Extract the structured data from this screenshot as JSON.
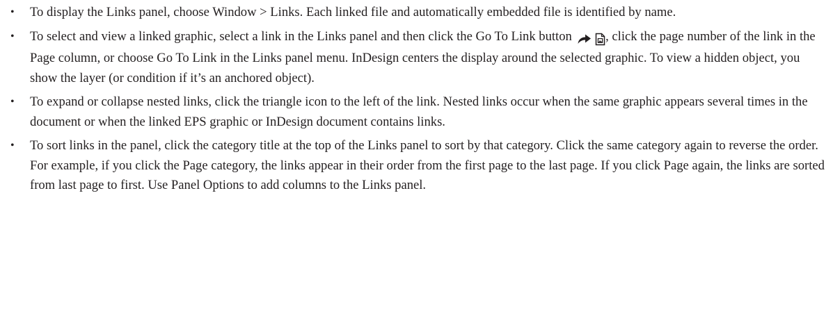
{
  "bullet_glyph": "•",
  "items": [
    {
      "text": "To display the Links panel, choose Window > Links. Each linked file and automatically embedded file is identified by name."
    },
    {
      "text_before_icon": "To select and view a linked graphic, select a link in the Links panel and then click the Go To Link button",
      "icon": "go-to-link-icon",
      "text_after_icon": ", click the page number of the link in the Page column, or choose Go To Link in the Links panel menu. InDesign centers the display around the selected graphic. To view a hidden object, you show the layer (or condition if it’s an anchored object)."
    },
    {
      "text": "To expand or collapse nested links, click the triangle icon to the left of the link. Nested links occur when the same graphic appears several times in the document or when the linked EPS graphic or InDesign document contains links."
    },
    {
      "text": "To sort links in the panel, click the category title at the top of the Links panel to sort by that category. Click the same category again to reverse the order. For example, if you click the Page category, the links appear in their order from the first page to the last page. If you click Page again, the links are sorted from last page to first. Use Panel Options to add columns to the Links panel."
    }
  ]
}
